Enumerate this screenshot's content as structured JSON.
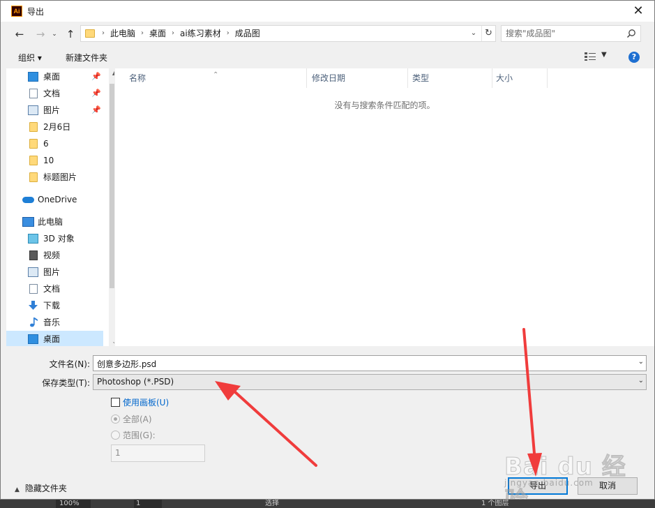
{
  "window": {
    "title": "导出",
    "app_icon_text": "Ai",
    "close_glyph": "✕"
  },
  "address": {
    "crumbs": [
      "此电脑",
      "桌面",
      "ai练习素材",
      "成品图"
    ],
    "search_placeholder": "搜索\"成品图\""
  },
  "toolbar": {
    "organize_label": "组织 ▾",
    "new_folder_label": "新建文件夹",
    "help_glyph": "?"
  },
  "nav": {
    "items": [
      {
        "label": "桌面",
        "icon": "desktop-icon",
        "pinned": true
      },
      {
        "label": "文档",
        "icon": "documents-icon",
        "pinned": true
      },
      {
        "label": "图片",
        "icon": "pictures-icon",
        "pinned": true
      },
      {
        "label": "2月6日",
        "icon": "folder-icon",
        "pinned": false
      },
      {
        "label": "6",
        "icon": "folder-icon",
        "pinned": false
      },
      {
        "label": "10",
        "icon": "folder-icon",
        "pinned": false
      },
      {
        "label": "标题图片",
        "icon": "folder-icon",
        "pinned": false
      },
      {
        "label": "OneDrive",
        "icon": "onedrive-icon",
        "pinned": false
      },
      {
        "label": "此电脑",
        "icon": "this-pc-icon",
        "pinned": false
      },
      {
        "label": "3D 对象",
        "icon": "3d-objects-icon",
        "pinned": false
      },
      {
        "label": "视频",
        "icon": "videos-icon",
        "pinned": false
      },
      {
        "label": "图片",
        "icon": "pictures-icon",
        "pinned": false
      },
      {
        "label": "文档",
        "icon": "documents-icon",
        "pinned": false
      },
      {
        "label": "下载",
        "icon": "downloads-icon",
        "pinned": false
      },
      {
        "label": "音乐",
        "icon": "music-icon",
        "pinned": false
      },
      {
        "label": "桌面",
        "icon": "desktop-icon",
        "pinned": false,
        "selected": true
      }
    ]
  },
  "content": {
    "columns": [
      "名称",
      "修改日期",
      "类型",
      "大小"
    ],
    "empty_message": "没有与搜索条件匹配的项。"
  },
  "form": {
    "filename_label": "文件名(N):",
    "filename_value": "创意多边形.psd",
    "filetype_label": "保存类型(T):",
    "filetype_value": "Photoshop (*.PSD)",
    "use_artboards_label": "使用画板(U)",
    "all_label": "全部(A)",
    "range_label": "范围(G):",
    "range_value": "1"
  },
  "footer": {
    "hide_folders_label": "隐藏文件夹",
    "export_label": "导出",
    "cancel_label": "取消"
  },
  "watermark": {
    "brand": "Bai du 经验",
    "url": "jingyan.baidu.com"
  },
  "statusbar": {
    "zoom": "100%",
    "page": "1",
    "tool": "选择",
    "layers": "1 个图层"
  },
  "colors": {
    "accent": "#0078d7",
    "annotation_arrow": "#f03c3c",
    "selection": "#cce8ff"
  }
}
